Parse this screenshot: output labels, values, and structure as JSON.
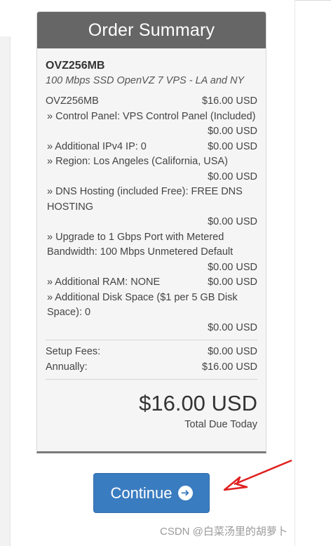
{
  "summary": {
    "title": "Order Summary",
    "product_name": "OVZ256MB",
    "product_desc": "100 Mbps SSD OpenVZ 7 VPS - LA and NY",
    "base_label": "OVZ256MB",
    "base_price": "$16.00 USD",
    "items": [
      {
        "label": "» Control Panel: VPS Control Panel (Included)",
        "price": "$0.00 USD"
      },
      {
        "label": "» Additional IPv4 IP: 0",
        "price": "$0.00 USD"
      },
      {
        "label": "» Region: Los Angeles (California, USA)",
        "price": "$0.00 USD"
      },
      {
        "label": "» DNS Hosting (included Free): FREE DNS HOSTING",
        "price": "$0.00 USD"
      },
      {
        "label": "» Upgrade to 1 Gbps Port with Metered Bandwidth: 100 Mbps Unmetered Default",
        "price": "$0.00 USD"
      },
      {
        "label": "» Additional RAM: NONE",
        "price": "$0.00 USD"
      },
      {
        "label": "» Additional Disk Space ($1 per 5 GB Disk Space): 0",
        "price": "$0.00 USD"
      }
    ],
    "setup_label": "Setup Fees:",
    "setup_price": "$0.00 USD",
    "annual_label": "Annually:",
    "annual_price": "$16.00 USD",
    "total": "$16.00 USD",
    "total_caption": "Total Due Today"
  },
  "actions": {
    "continue_label": "Continue"
  },
  "icons": {
    "continue": "arrow-circle-right-icon",
    "annotation": "red-arrow-annotation"
  },
  "colors": {
    "header_bg": "#666666",
    "button_bg": "#3a7cc0",
    "annotation": "#e02020"
  },
  "watermark": "CSDN @白菜汤里的胡萝卜"
}
